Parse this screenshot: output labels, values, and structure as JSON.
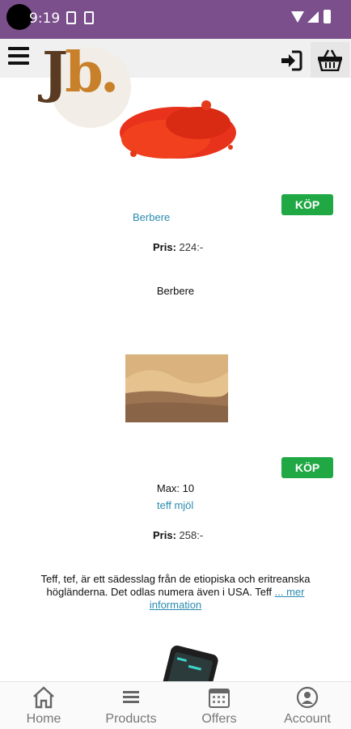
{
  "status_bar": {
    "time": "9:19"
  },
  "header": {
    "logo_text_j": "J",
    "logo_text_b": "b.",
    "menu_icon": "hamburger-menu-icon",
    "login_icon": "login-arrow-icon",
    "cart_icon": "shopping-basket-icon"
  },
  "products": [
    {
      "buy_label": "KÖP",
      "name": "Berbere",
      "price_label": "Pris:",
      "price_value": " 224:-",
      "description": "Berbere"
    },
    {
      "buy_label": "KÖP",
      "max": "Max: 10",
      "name": "teff mjöl",
      "price_label": "Pris:",
      "price_value": " 258:-",
      "description": "Teff, tef, är ett sädesslag från de etiopiska och eritreanska högländerna. Det odlas numera även i USA. Teff",
      "more_link": "... mer information"
    }
  ],
  "bottom_nav": [
    {
      "label": "Home",
      "icon": "home-icon"
    },
    {
      "label": "Products",
      "icon": "list-icon"
    },
    {
      "label": "Offers",
      "icon": "calendar-icon"
    },
    {
      "label": "Account",
      "icon": "account-icon"
    }
  ],
  "colors": {
    "status_bar": "#7a4f8c",
    "buy_button": "#1fa844",
    "link": "#2a8bb0"
  }
}
